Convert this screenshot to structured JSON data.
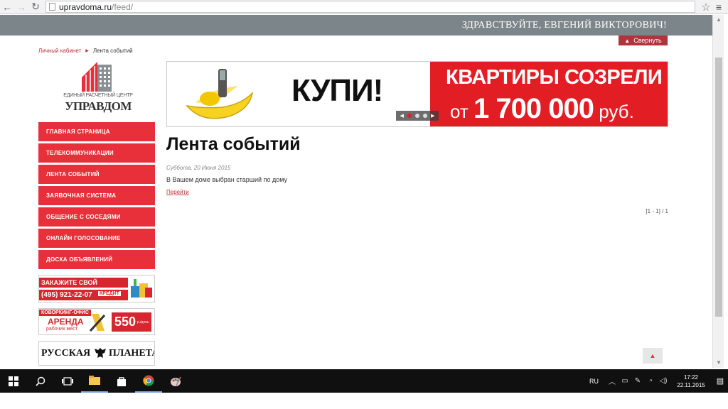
{
  "browser": {
    "url_host": "upravdoma.ru",
    "url_path": "/feed/"
  },
  "header": {
    "greeting": "ЗДРАВСТВУЙТЕ, ЕВГЕНИЙ ВИКТОРОВИЧ!",
    "collapse_label": "Свернуть"
  },
  "breadcrumb": {
    "items": [
      "Личный кабинет",
      "Лента событий"
    ]
  },
  "logo": {
    "subtitle": "ЕДИНЫЙ РАСЧЕТНЫЙ ЦЕНТР",
    "name": "УПРАВДОМ"
  },
  "sidebar": {
    "items": [
      {
        "label": "ГЛАВНАЯ СТРАНИЦА"
      },
      {
        "label": "ТЕЛЕКОММУНИКАЦИИ"
      },
      {
        "label": "ЛЕНТА СОБЫТИЙ"
      },
      {
        "label": "ЗАЯВОЧНАЯ СИСТЕМА"
      },
      {
        "label": "ОБЩЕНИЕ С СОСЕДЯМИ"
      },
      {
        "label": "ОНЛАЙН ГОЛОСОВАНИЕ"
      },
      {
        "label": "ДОСКА ОБЪЯВЛЕНИЙ"
      }
    ],
    "ads": {
      "repair": {
        "line1": "ЗАКАЖИТЕ СВОЙ РЕМОНТ!",
        "phone": "(495) 921-22-07",
        "credit": "КРЕДИТ"
      },
      "cowork": {
        "line1": "КОВОРКИНГ-ОФИС",
        "line2": "АРЕНДА",
        "line3": "рабочих мест",
        "price": "550",
        "unit": "р./день"
      },
      "planet": {
        "word1": "РУССКАЯ",
        "word2": "ПЛАНЕТА"
      }
    }
  },
  "banner": {
    "buy": "КУПИ!",
    "headline": "КВАРТИРЫ СОЗРЕЛИ",
    "price_prefix": "от",
    "price": "1 700 000",
    "price_suffix": "руб.",
    "slides": 3,
    "active_slide": 1
  },
  "main": {
    "title": "Лента событий",
    "events": [
      {
        "date": "Суббота, 20 Июня 2015",
        "text": "В Вашем доме выбран старший по дому",
        "link": "Перейти"
      }
    ],
    "pager": "[1 - 1] / 1"
  },
  "taskbar": {
    "lang": "RU",
    "time": "17:22",
    "date": "22.11.2015"
  },
  "colors": {
    "accent_red": "#e8303a",
    "header_gray": "#7c8589",
    "banner_red": "#e21d24"
  }
}
